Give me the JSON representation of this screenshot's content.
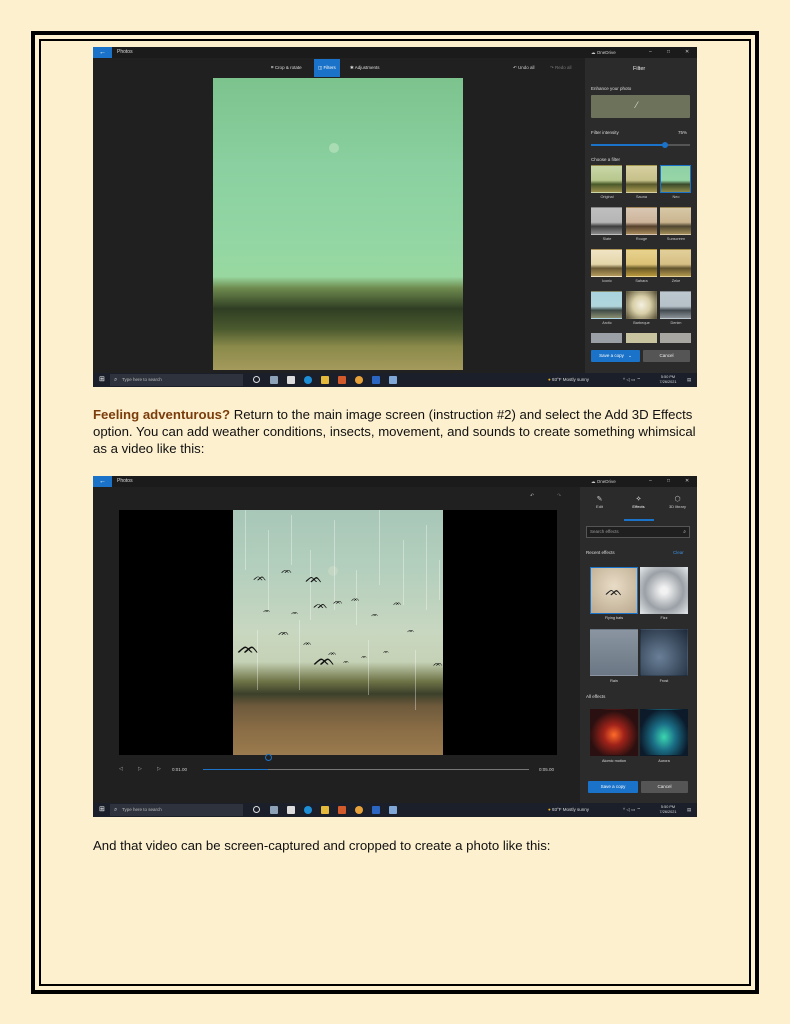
{
  "colors": {
    "accent": "#1a73c8",
    "page_bg": "#fdf0cf",
    "highlight": "#7b3c0c"
  },
  "screenshot1": {
    "app_title": "Photos",
    "onedrive": "OneDrive",
    "toolbar_tabs": [
      "Crop & rotate",
      "Filters",
      "Adjustments"
    ],
    "undo_all": "Undo all",
    "redo_all": "Redo all",
    "panel_title": "Filter",
    "enhance_label": "Enhance your photo",
    "intensity_label": "Filter intensity",
    "intensity_value": "75%",
    "intensity_level": 0.75,
    "choose_filter": "Choose a filter",
    "filters": [
      "Original",
      "Sauna",
      "Neo",
      "Slate",
      "Rouge",
      "Sunscreen",
      "Iconic",
      "Sahara",
      "Zeke",
      "Arctic",
      "Barbeque",
      "Denim"
    ],
    "save_copy": "Save a copy",
    "cancel": "Cancel"
  },
  "paragraph1": {
    "highlight": "Feeling adventurous?",
    "text": " Return to the main image screen (instruction #2) and select the Add 3D Effects option. You can add weather conditions, insects, movement, and sounds to create something whimsical as a video like this:"
  },
  "screenshot2": {
    "app_title": "Photos",
    "onedrive": "OneDrive",
    "tabs": [
      "Edit",
      "Effects",
      "3D library"
    ],
    "search_placeholder": "Search effects",
    "recent_effects": "Recent effects",
    "clear": "Clear",
    "recent": [
      "Flying bats",
      "Fizz",
      "Rain",
      "Frost"
    ],
    "all_effects": "All effects",
    "all": [
      "Atomic motion",
      "Aurora"
    ],
    "time_current": "0:01.00",
    "time_total": "0:05.00",
    "seek_level": 0.2,
    "save_copy": "Save a copy",
    "cancel": "Cancel"
  },
  "taskbar": {
    "search_placeholder": "Type here to search",
    "weather": "93°F  Mostly sunny",
    "time": "5:50 PM",
    "date": "7/26/2021"
  },
  "paragraph2": "And that video can be screen-captured and cropped to create a photo like this:"
}
